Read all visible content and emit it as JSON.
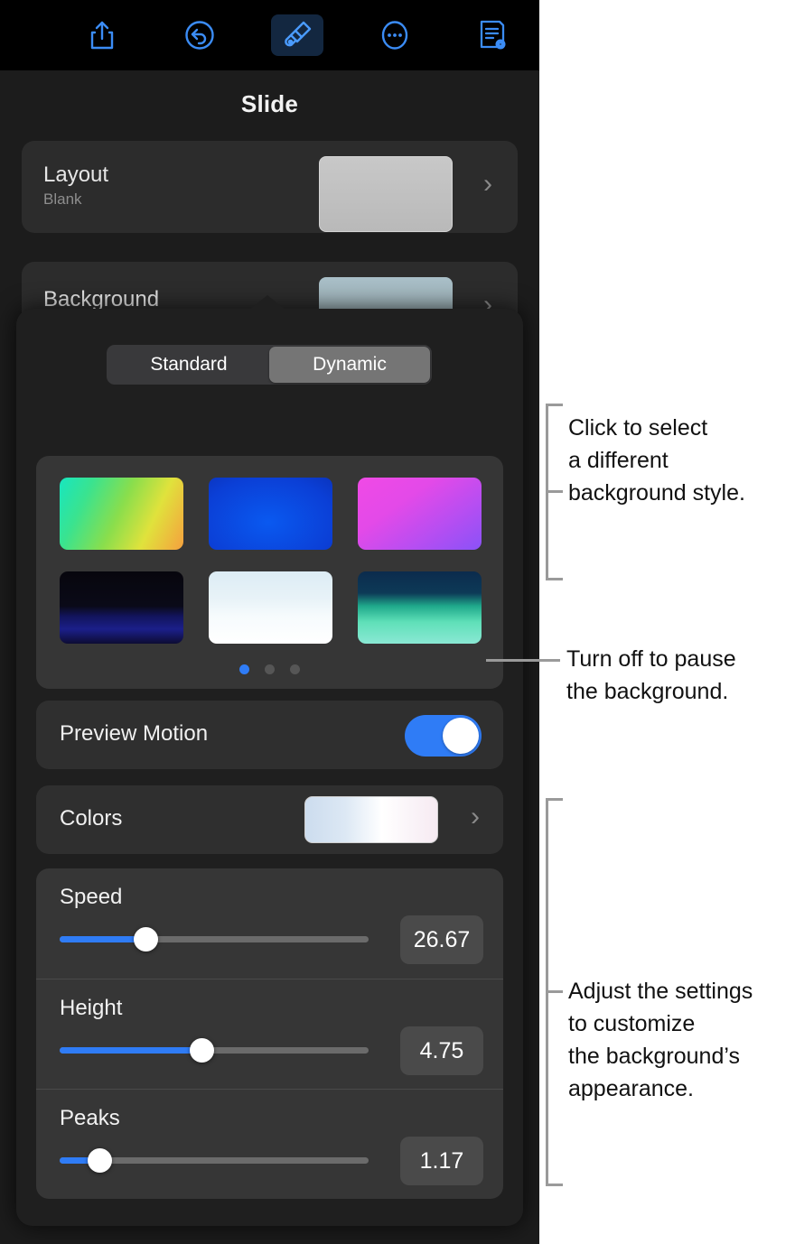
{
  "toolbar": {
    "items": [
      {
        "name": "share-icon",
        "label": "Share"
      },
      {
        "name": "undo-icon",
        "label": "Undo"
      },
      {
        "name": "brush-icon",
        "label": "Format",
        "selected": true
      },
      {
        "name": "more-icon",
        "label": "More"
      },
      {
        "name": "document-icon",
        "label": "Document Options"
      }
    ]
  },
  "inspector": {
    "title": "Slide",
    "layout": {
      "label": "Layout",
      "value": "Blank",
      "chevron": "›"
    },
    "background": {
      "label": "Background",
      "chevron": "›"
    }
  },
  "popover": {
    "segmented": {
      "options": [
        "Standard",
        "Dynamic"
      ],
      "selected": "Dynamic"
    },
    "styles": {
      "swatches": [
        {
          "name": "gradient-green-yellow-orange",
          "css": "linear-gradient(115deg, #17e6c0 0%, #3ae38f 22%, #8ade4c 48%, #e0e23c 72%, #f5a03e 100%)"
        },
        {
          "name": "gradient-deep-blue",
          "css": "radial-gradient(120% 140% at 48% 62%, #0a59f0 0%, #0b3fd6 45%, #0a2aa8 78%, #0a2184 100%)"
        },
        {
          "name": "gradient-magenta-purple",
          "css": "linear-gradient(145deg, #f04ae6 0%, #e34ae8 35%, #b44ef2 70%, #8a52f7 100%)"
        },
        {
          "name": "dark-night-waves",
          "css": "linear-gradient(180deg, #07060d 0%, #0a0a18 48%, #12145c 62%, #1b1f8a 80%, #0d0c33 100%)"
        },
        {
          "name": "light-white-sky",
          "css": "linear-gradient(180deg, #dcecf4 0%, #e9f3f8 40%, #f6fbfd 62%, #ffffff 100%)"
        },
        {
          "name": "teal-mountain-night",
          "css": "linear-gradient(180deg, #0b2b4d 0%, #0d3a57 30%, #1fa98b 48%, #5fe0b8 70%, #8ae8d4 100%)"
        }
      ],
      "page_dots": {
        "count": 3,
        "active_index": 0
      }
    },
    "preview_motion": {
      "label": "Preview Motion",
      "enabled": true
    },
    "colors": {
      "label": "Colors",
      "chevron": "›"
    },
    "sliders": [
      {
        "label": "Speed",
        "value": "26.67",
        "percent": 28
      },
      {
        "label": "Height",
        "value": "4.75",
        "percent": 46
      },
      {
        "label": "Peaks",
        "value": "1.17",
        "percent": 13
      }
    ]
  },
  "callouts": [
    {
      "name": "callout-background-styles",
      "text": "Click to select\na different\nbackground style."
    },
    {
      "name": "callout-preview-motion",
      "text": "Turn off to pause\nthe background."
    },
    {
      "name": "callout-settings",
      "text": "Adjust the settings\nto customize\nthe background’s\nappearance."
    }
  ],
  "colors": {
    "accent_blue": "#2f7cf6",
    "toolbar_icon_blue": "#3b8cf5",
    "panel_bg": "#1c1c1c",
    "popover_bg": "#1f1f1f",
    "callout_line": "#9a9a9a"
  }
}
